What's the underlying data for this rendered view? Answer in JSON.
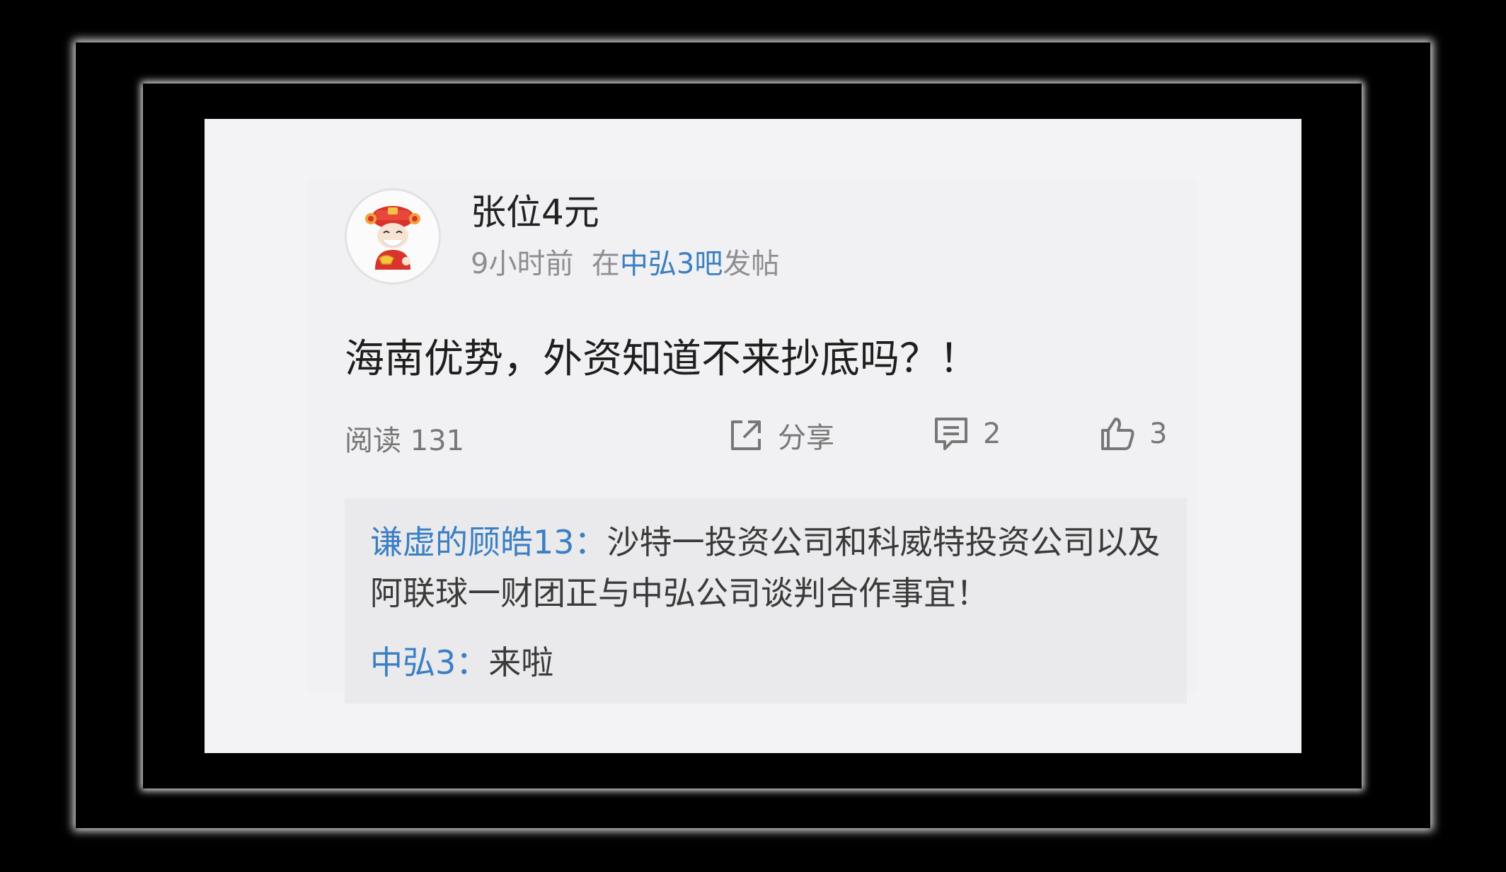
{
  "post": {
    "username": "张位4元",
    "time": "9小时前",
    "in_prefix": "在",
    "forum": "中弘3吧",
    "posted_suffix": "发帖",
    "text": "海南优势，外资知道不来抄底吗？！"
  },
  "stats": {
    "read_label": "阅读 131",
    "share_label": "分享",
    "comment_count": "2",
    "like_count": "3"
  },
  "comments": [
    {
      "author": "谦虚的顾皓13：",
      "text": "沙特一投资公司和科威特投资公司以及阿联球一财团正与中弘公司谈判合作事宜！"
    },
    {
      "author": "中弘3：",
      "text": "来啦"
    }
  ],
  "colors": {
    "link": "#3b7fc4",
    "text": "#1e1e1e",
    "muted": "#8e8e92",
    "background": "#f3f3f5"
  },
  "icons": {
    "share": "share-icon",
    "comment": "comment-icon",
    "like": "thumbs-up-icon",
    "avatar": "fortune-god-avatar"
  }
}
